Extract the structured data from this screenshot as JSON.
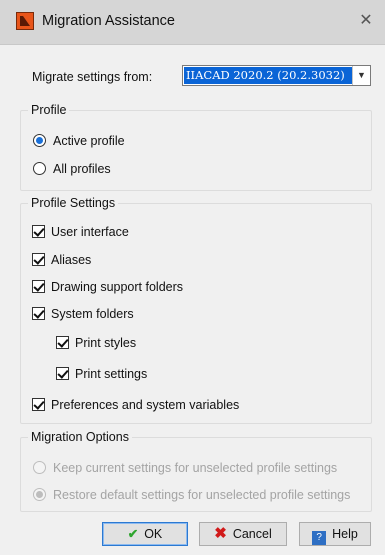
{
  "window": {
    "title": "Migration Assistance",
    "close_glyph": "✕"
  },
  "migrate": {
    "label": "Migrate settings from:",
    "selected": "IIACAD 2020.2 (20.2.3032)"
  },
  "profile": {
    "title": "Profile",
    "options": [
      {
        "label": "Active profile",
        "selected": true
      },
      {
        "label": "All profiles",
        "selected": false
      }
    ]
  },
  "profile_settings": {
    "title": "Profile Settings",
    "items": [
      {
        "label": "User interface",
        "checked": true
      },
      {
        "label": "Aliases",
        "checked": true
      },
      {
        "label": "Drawing support folders",
        "checked": true
      },
      {
        "label": "System folders",
        "checked": true
      },
      {
        "label": "Print styles",
        "checked": true
      },
      {
        "label": "Print settings",
        "checked": true
      },
      {
        "label": "Preferences and system variables",
        "checked": true
      }
    ]
  },
  "migration_options": {
    "title": "Migration Options",
    "options": [
      {
        "label": "Keep current settings for unselected profile settings",
        "selected": false,
        "enabled": false
      },
      {
        "label": "Restore default settings for unselected profile settings",
        "selected": true,
        "enabled": false
      }
    ]
  },
  "buttons": {
    "ok": "OK",
    "cancel": "Cancel",
    "help": "Help"
  },
  "icons": {
    "ok": "check-icon",
    "cancel": "x-icon",
    "help": "help-icon"
  },
  "colors": {
    "accent": "#1a70d8",
    "selection": "#0a64d6",
    "ok_icon": "#2fa52f",
    "cancel_icon": "#d11a1a"
  }
}
